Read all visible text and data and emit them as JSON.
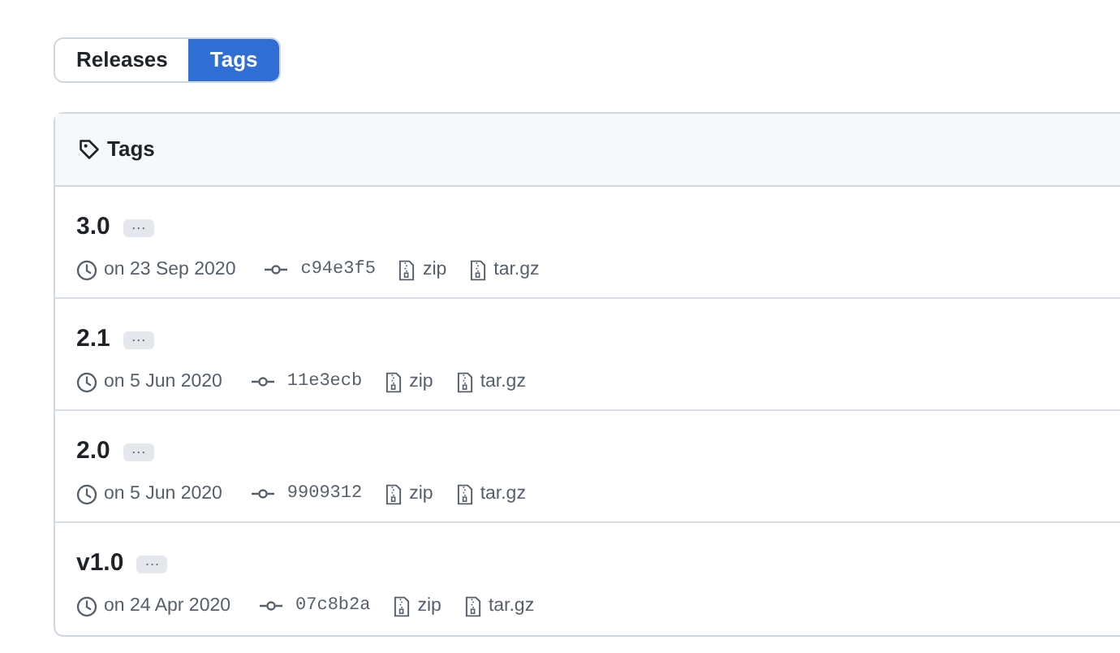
{
  "tabs": [
    {
      "label": "Releases",
      "selected": false
    },
    {
      "label": "Tags",
      "selected": true
    }
  ],
  "panel": {
    "title": "Tags"
  },
  "tags": [
    {
      "name": "3.0",
      "more": "···",
      "date": "on 23 Sep 2020",
      "commit": "c94e3f5",
      "downloads": [
        "zip",
        "tar.gz"
      ]
    },
    {
      "name": "2.1",
      "more": "···",
      "date": "on 5 Jun 2020",
      "commit": "11e3ecb",
      "downloads": [
        "zip",
        "tar.gz"
      ]
    },
    {
      "name": "2.0",
      "more": "···",
      "date": "on 5 Jun 2020",
      "commit": "9909312",
      "downloads": [
        "zip",
        "tar.gz"
      ]
    },
    {
      "name": "v1.0",
      "more": "···",
      "date": "on 24 Apr 2020",
      "commit": "07c8b2a",
      "downloads": [
        "zip",
        "tar.gz"
      ]
    }
  ]
}
